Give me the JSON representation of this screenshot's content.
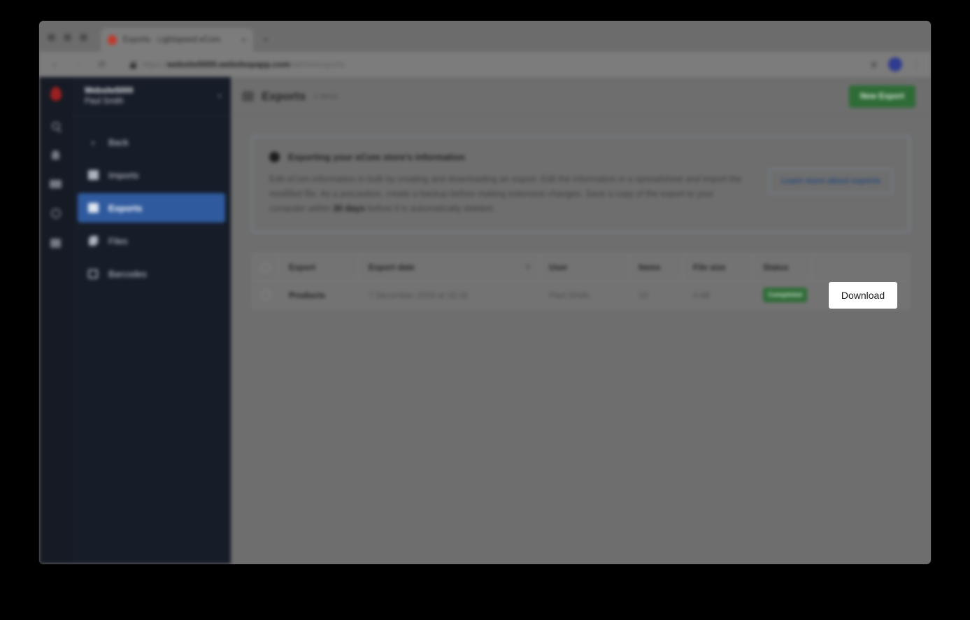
{
  "browser": {
    "tab": {
      "title": "Exports · Lightspeed eCom",
      "close_label": "×",
      "favicon": "lightspeed-flame-icon"
    },
    "new_tab_label": "+",
    "nav": {
      "back": "‹",
      "forward": "›",
      "reload": "⟳"
    },
    "url": {
      "scheme": "https://",
      "host": "website5000.webshopapp.com",
      "path": "/admin/exports"
    },
    "toolbar_right": {
      "extension": "extension-icon",
      "avatar": "user-avatar",
      "menu": "⋮"
    }
  },
  "rail": {
    "logo": "lightspeed-logo",
    "icons": [
      "search-icon",
      "notifications-icon",
      "inbox-icon",
      "help-globe-icon",
      "apps-grid-icon"
    ]
  },
  "sidebar": {
    "store_name": "Website5000",
    "user_name": "Paul Smith",
    "caret": "▾",
    "items": [
      {
        "label": "Back",
        "icon": "chevron-left-icon",
        "active": false
      },
      {
        "label": "Imports",
        "icon": "imports-icon",
        "active": false
      },
      {
        "label": "Exports",
        "icon": "exports-icon",
        "active": true
      },
      {
        "label": "Files",
        "icon": "files-icon",
        "active": false
      },
      {
        "label": "Barcodes",
        "icon": "barcodes-icon",
        "active": false
      }
    ]
  },
  "header": {
    "icon": "exports-icon",
    "title": "Exports",
    "count": "1 items",
    "new_export_label": "New Export"
  },
  "banner": {
    "icon": "info-circle-icon",
    "title": "Exporting your eCom store's information",
    "text_before": "Edit eCom information in bulk by creating and downloading an export. Edit the information in a spreadsheet and import the modified file. As a precaution, create a backup before making extensive changes. Save a copy of the export to your computer within ",
    "text_bold": "30 days",
    "text_after": " before it is automatically deleted.",
    "learn_more_label": "Learn more about exports"
  },
  "table": {
    "columns": [
      "Export",
      "Export date",
      "User",
      "Items",
      "File size",
      "Status",
      ""
    ],
    "sort_indicator": "⇅",
    "rows": [
      {
        "export": "Products",
        "date": "7 December 2018 at 16:16",
        "user": "Paul Smith",
        "items": "10",
        "file_size": "4 kB",
        "status": "Completed"
      }
    ]
  },
  "overlay": {
    "download_label": "Download"
  },
  "colors": {
    "accent_green": "#2e6b36",
    "sidebar_active": "#2f5a9e",
    "sidebar_bg": "#161c28",
    "rail_bg": "#151a24"
  }
}
